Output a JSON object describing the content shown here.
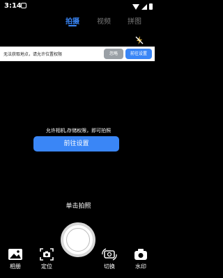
{
  "status_bar": {
    "time": "3:14"
  },
  "mode_tabs": [
    {
      "label": "拍摄"
    },
    {
      "label": "视频"
    },
    {
      "label": "拼图"
    }
  ],
  "location_banner": {
    "text": "无法获取地点，请允许位置权限",
    "ignore_label": "忽略",
    "goto_label": "前往设置"
  },
  "permission": {
    "text": "允许相机,存储权限，即可拍照",
    "button_label": "前往设置"
  },
  "tap_hint": "单击拍照",
  "bottom_bar": {
    "album": "相册",
    "location": "定位",
    "switch": "切换",
    "watermark": "水印"
  },
  "colors": {
    "accent": "#3a86f6",
    "background": "#000000",
    "banner": "#ffffff",
    "ignore_button": "#9aa0a6"
  },
  "icons": [
    "flash-off-icon",
    "image-icon",
    "location-camera-icon",
    "switch-camera-icon",
    "camera-icon"
  ]
}
